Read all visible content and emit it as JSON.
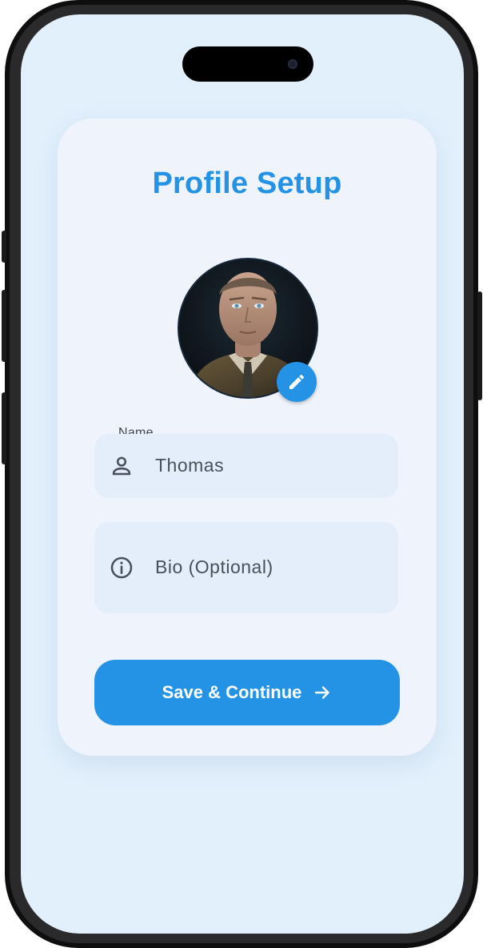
{
  "profile": {
    "title": "Profile Setup",
    "avatar_alt": "profile photo"
  },
  "form": {
    "name_label": "Name",
    "name_value": "Thomas",
    "bio_placeholder": "Bio (Optional)",
    "bio_value": ""
  },
  "actions": {
    "save_label": "Save & Continue"
  },
  "icons": {
    "edit": "pencil-icon",
    "name": "person-icon",
    "bio": "info-icon",
    "save": "arrow-right-icon"
  },
  "colors": {
    "accent": "#2493e6",
    "screen_bg": "#e2f0fc",
    "card_bg": "#eff3fb",
    "field_bg": "#e4eefa"
  }
}
